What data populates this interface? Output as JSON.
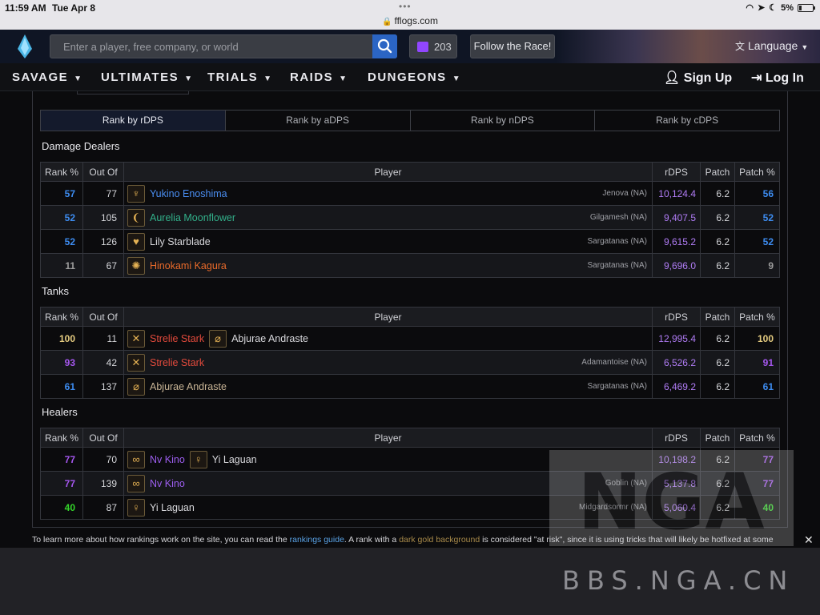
{
  "status": {
    "time": "11:59 AM",
    "date": "Tue Apr 8",
    "url": "fflogs.com",
    "battery": "5%"
  },
  "header": {
    "search_placeholder": "Enter a player, free company, or world",
    "twitch_count": "203",
    "follow_label": "Follow the Race!",
    "language_label": "Language"
  },
  "nav": {
    "items": [
      "SAVAGE",
      "ULTIMATES",
      "TRIALS",
      "RAIDS",
      "DUNGEONS"
    ],
    "signup": "Sign Up",
    "login": "Log In"
  },
  "rank_tabs": [
    "Rank by rDPS",
    "Rank by aDPS",
    "Rank by nDPS",
    "Rank by cDPS"
  ],
  "columns": [
    "Rank %",
    "Out Of",
    "Player",
    "rDPS",
    "Patch",
    "Patch %"
  ],
  "colors": {
    "blue": "#3d8cf0",
    "purple": "#a557ef",
    "gray": "#9c9c9c",
    "orange": "#ff8000",
    "green": "#34d62a",
    "gold": "#e5cc80"
  },
  "sections": [
    {
      "title": "Damage Dealers",
      "rows": [
        {
          "rank": "57",
          "out": "77",
          "icon": "samurai-icon",
          "glyph": "♆",
          "name": "Yukino Enoshima",
          "name_color": "#4a8ef2",
          "server": "Jenova (NA)",
          "dps": "10,124.4",
          "patch": "6.2",
          "ppct": "56",
          "rank_color": "#3d8cf0",
          "ppct_color": "#3d8cf0"
        },
        {
          "rank": "52",
          "out": "105",
          "icon": "bard-icon",
          "glyph": "❨",
          "name": "Aurelia Moonflower",
          "name_color": "#32b08a",
          "server": "Gilgamesh (NA)",
          "dps": "9,407.5",
          "patch": "6.2",
          "ppct": "52",
          "rank_color": "#3d8cf0",
          "ppct_color": "#3d8cf0"
        },
        {
          "rank": "52",
          "out": "126",
          "icon": "dragoon-icon",
          "glyph": "♥",
          "name": "Lily Starblade",
          "name_color": "#d8d8dc",
          "server": "Sargatanas (NA)",
          "dps": "9,615.2",
          "patch": "6.2",
          "ppct": "52",
          "rank_color": "#3d8cf0",
          "ppct_color": "#3d8cf0"
        },
        {
          "rank": "11",
          "out": "67",
          "icon": "reaper-icon",
          "glyph": "✺",
          "name": "Hinokami Kagura",
          "name_color": "#e96a2a",
          "server": "Sargatanas (NA)",
          "dps": "9,696.0",
          "patch": "6.2",
          "ppct": "9",
          "rank_color": "#9c9c9c",
          "ppct_color": "#9c9c9c"
        }
      ]
    },
    {
      "title": "Tanks",
      "rows": [
        {
          "rank": "100",
          "out": "11",
          "icon": "gunbreaker-icon",
          "glyph": "✕",
          "name": "Strelie Stark",
          "name_color": "#e24a3c",
          "partner_icon": "paladin-icon",
          "partner_glyph": "⌀",
          "partner": "Abjurae Andraste",
          "server": "",
          "dps": "12,995.4",
          "patch": "6.2",
          "ppct": "100",
          "rank_color": "#e5cc80",
          "ppct_color": "#e5cc80"
        },
        {
          "rank": "93",
          "out": "42",
          "icon": "gunbreaker-icon",
          "glyph": "✕",
          "name": "Strelie Stark",
          "name_color": "#e24a3c",
          "server": "Adamantoise (NA)",
          "dps": "6,526.2",
          "patch": "6.2",
          "ppct": "91",
          "rank_color": "#a557ef",
          "ppct_color": "#a557ef"
        },
        {
          "rank": "61",
          "out": "137",
          "icon": "paladin-icon",
          "glyph": "⌀",
          "name": "Abjurae Andraste",
          "name_color": "#c9b596",
          "server": "Sargatanas (NA)",
          "dps": "6,469.2",
          "patch": "6.2",
          "ppct": "61",
          "rank_color": "#3d8cf0",
          "ppct_color": "#3d8cf0"
        }
      ]
    },
    {
      "title": "Healers",
      "rows": [
        {
          "rank": "77",
          "out": "70",
          "icon": "sage-icon",
          "glyph": "∞",
          "name": "Nv Kino",
          "name_color": "#9d5ef0",
          "partner_icon": "white-mage-icon",
          "partner_glyph": "♀",
          "partner": "Yi Laguan",
          "server": "",
          "dps": "10,198.2",
          "patch": "6.2",
          "ppct": "77",
          "rank_color": "#a557ef",
          "ppct_color": "#a557ef"
        },
        {
          "rank": "77",
          "out": "139",
          "icon": "sage-icon",
          "glyph": "∞",
          "name": "Nv Kino",
          "name_color": "#9d5ef0",
          "server": "Goblin (NA)",
          "dps": "5,137.8",
          "patch": "6.2",
          "ppct": "77",
          "rank_color": "#a557ef",
          "ppct_color": "#a557ef"
        },
        {
          "rank": "40",
          "out": "87",
          "icon": "white-mage-icon",
          "glyph": "♀",
          "name": "Yi Laguan",
          "name_color": "#d8d8dc",
          "server": "Midgardsormr (NA)",
          "dps": "5,060.4",
          "patch": "6.2",
          "ppct": "40",
          "rank_color": "#34d62a",
          "ppct_color": "#34d62a"
        }
      ]
    }
  ],
  "footer": {
    "text1": "To learn more about how rankings work on the site, you can read the ",
    "link": "rankings guide",
    "text2": ". A rank with a ",
    "gold": "dark gold background",
    "text3": " is considered \"at risk\", since it is using tricks that will likely be hotfixed at some"
  },
  "watermark": {
    "text": "BBS.NGA.CN",
    "logo": "NGA"
  }
}
